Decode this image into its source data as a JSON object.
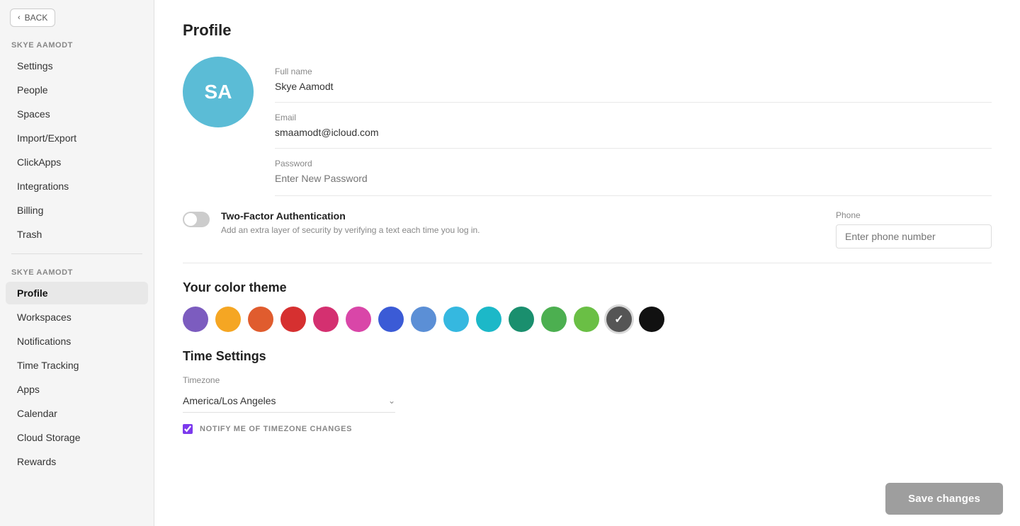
{
  "sidebar": {
    "back_label": "BACK",
    "section1_title": "SKYE AAMODT",
    "items1": [
      {
        "label": "Settings",
        "id": "settings",
        "active": false
      },
      {
        "label": "People",
        "id": "people",
        "active": false
      },
      {
        "label": "Spaces",
        "id": "spaces",
        "active": false
      },
      {
        "label": "Import/Export",
        "id": "import-export",
        "active": false
      },
      {
        "label": "ClickApps",
        "id": "clickapps",
        "active": false
      },
      {
        "label": "Integrations",
        "id": "integrations",
        "active": false
      },
      {
        "label": "Billing",
        "id": "billing",
        "active": false
      },
      {
        "label": "Trash",
        "id": "trash",
        "active": false
      }
    ],
    "section2_title": "SKYE AAMODT",
    "items2": [
      {
        "label": "Profile",
        "id": "profile",
        "active": true
      },
      {
        "label": "Workspaces",
        "id": "workspaces",
        "active": false
      },
      {
        "label": "Notifications",
        "id": "notifications",
        "active": false
      },
      {
        "label": "Time Tracking",
        "id": "time-tracking",
        "active": false
      },
      {
        "label": "Apps",
        "id": "apps",
        "active": false
      },
      {
        "label": "Calendar",
        "id": "calendar",
        "active": false
      },
      {
        "label": "Cloud Storage",
        "id": "cloud-storage",
        "active": false
      },
      {
        "label": "Rewards",
        "id": "rewards",
        "active": false
      }
    ]
  },
  "main": {
    "page_title": "Profile",
    "avatar_initials": "SA",
    "full_name_label": "Full name",
    "full_name_value": "Skye Aamodt",
    "email_label": "Email",
    "email_value": "smaamodt@icloud.com",
    "password_label": "Password",
    "password_placeholder": "Enter New Password",
    "tfa_title": "Two-Factor Authentication",
    "tfa_desc": "Add an extra layer of security by verifying a text each time you log in.",
    "phone_label": "Phone",
    "phone_placeholder": "Enter phone number",
    "color_theme_title": "Your color theme",
    "colors": [
      {
        "hex": "#7c5cbf",
        "id": "purple"
      },
      {
        "hex": "#f5a623",
        "id": "orange"
      },
      {
        "hex": "#e05c2e",
        "id": "red-orange"
      },
      {
        "hex": "#d63030",
        "id": "red"
      },
      {
        "hex": "#d43070",
        "id": "pink-red"
      },
      {
        "hex": "#d946a8",
        "id": "pink"
      },
      {
        "hex": "#3b5bd6",
        "id": "blue"
      },
      {
        "hex": "#5b8fd6",
        "id": "light-blue"
      },
      {
        "hex": "#35b8e0",
        "id": "sky"
      },
      {
        "hex": "#1cb8c8",
        "id": "teal"
      },
      {
        "hex": "#1a8f6e",
        "id": "dark-teal"
      },
      {
        "hex": "#4caf50",
        "id": "light-green"
      },
      {
        "hex": "#6abf45",
        "id": "green"
      },
      {
        "hex": "#555555",
        "id": "dark-gray",
        "selected": true
      },
      {
        "hex": "#111111",
        "id": "black"
      }
    ],
    "time_settings_title": "Time Settings",
    "timezone_label": "Timezone",
    "timezone_value": "America/Los Angeles",
    "notify_label": "NOTIFY ME OF TIMEZONE CHANGES",
    "save_label": "Save changes"
  }
}
